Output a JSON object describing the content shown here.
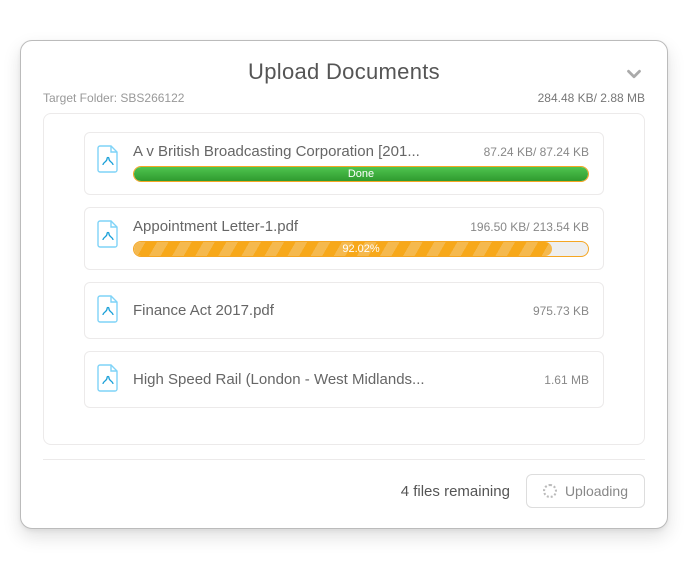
{
  "header": {
    "title": "Upload Documents"
  },
  "meta": {
    "target_label": "Target Folder:",
    "target_folder": "SBS266122",
    "totals": "284.48 KB/ 2.88 MB"
  },
  "files": [
    {
      "name": "A v British Broadcasting Corporation [201...",
      "size": "87.24 KB/ 87.24 KB",
      "status": "done",
      "progress_label": "Done",
      "progress_pct": 100
    },
    {
      "name": "Appointment Letter-1.pdf",
      "size": "196.50 KB/ 213.54 KB",
      "status": "uploading",
      "progress_label": "92.02%",
      "progress_pct": 92.02
    },
    {
      "name": "Finance Act 2017.pdf",
      "size": "975.73 KB",
      "status": "queued"
    },
    {
      "name": "High Speed Rail (London - West Midlands...",
      "size": "1.61 MB",
      "status": "queued"
    }
  ],
  "footer": {
    "remaining": "4 files remaining",
    "button": "Uploading"
  }
}
